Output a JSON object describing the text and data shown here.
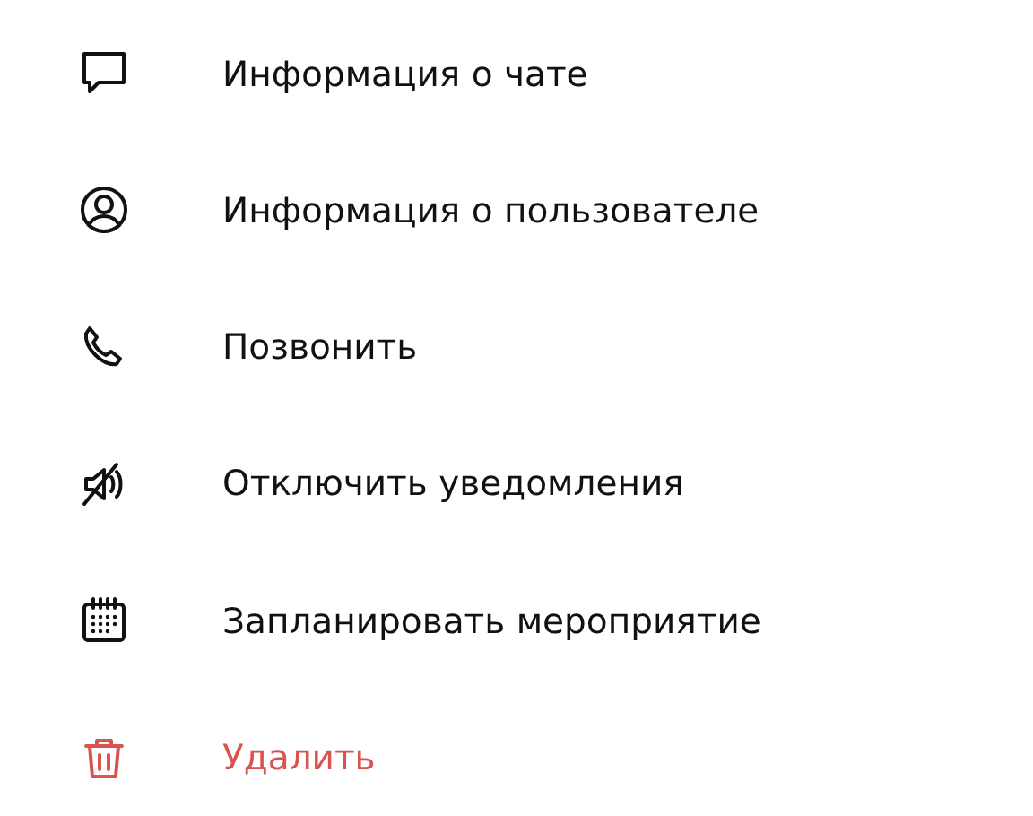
{
  "menu": {
    "items": [
      {
        "label": "Информация о чате",
        "destructive": false
      },
      {
        "label": "Информация о пользователе",
        "destructive": false
      },
      {
        "label": "Позвонить",
        "destructive": false
      },
      {
        "label": "Отключить уведомления",
        "destructive": false
      },
      {
        "label": "Запланировать мероприятие",
        "destructive": false
      },
      {
        "label": "Удалить",
        "destructive": true
      }
    ]
  }
}
